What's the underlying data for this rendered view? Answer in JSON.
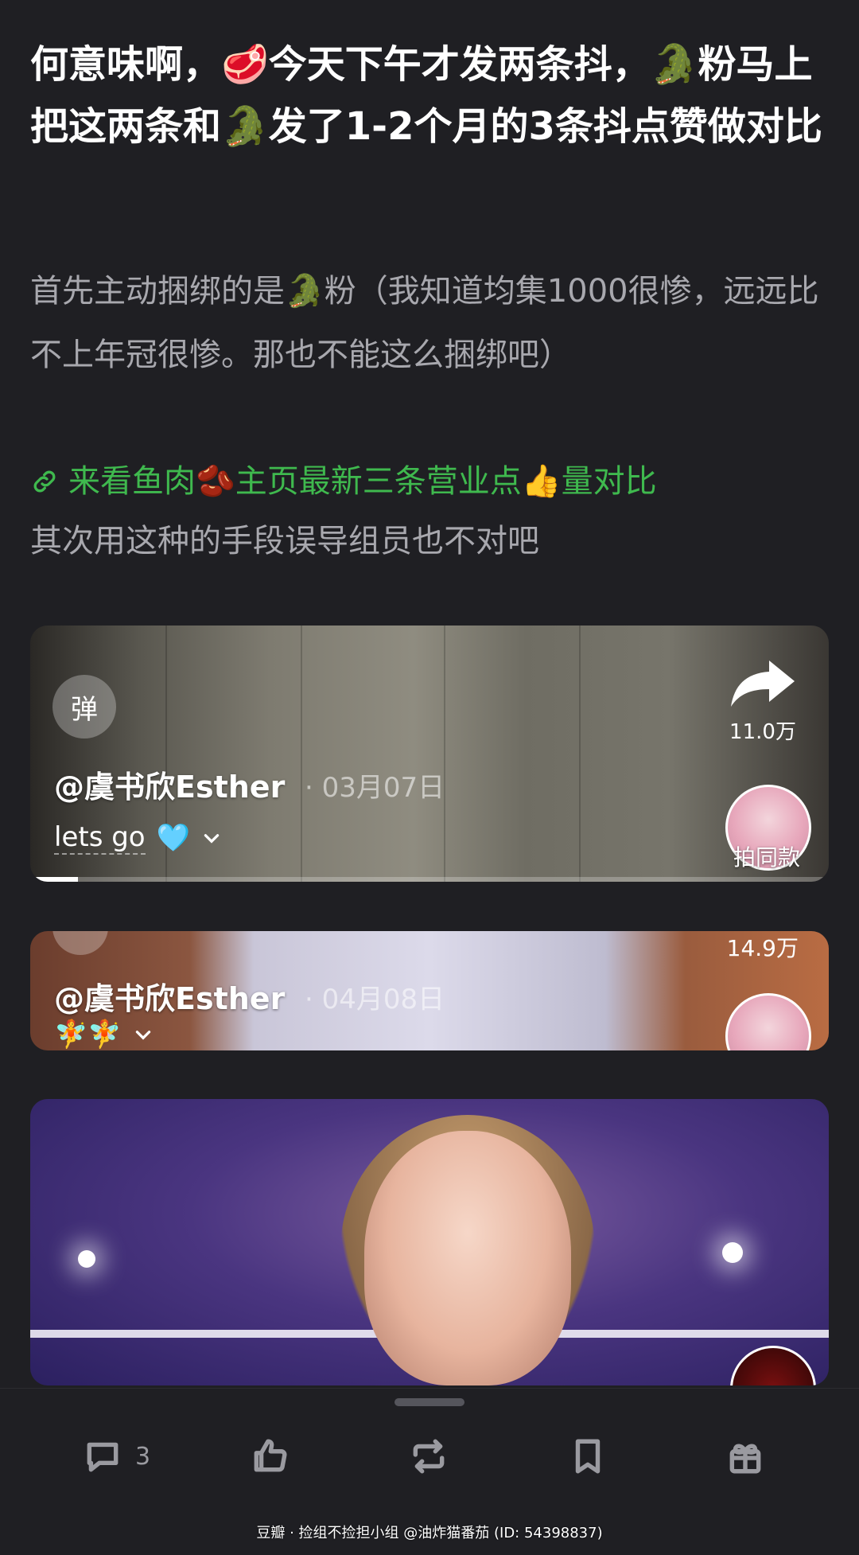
{
  "post": {
    "title": "何意味啊，🥩今天下午才发两条抖，🐊粉马上把这两条和🐊发了1-2个月的3条抖点赞做对比",
    "paragraph1": "首先主动捆绑的是🐊粉（我知道均集1000很惨，远远比不上年冠很惨。那也不能这么捆绑吧）",
    "link_text": "来看鱼肉🫘主页最新三条营业点👍量对比",
    "paragraph2": "其次用这种的手段误导组员也不对吧"
  },
  "videos": [
    {
      "danmu_label": "弹",
      "author": "@虞书欣Esther",
      "date": "· 03月07日",
      "caption": "lets go",
      "caption_emoji": "🩵",
      "share_count": "11.0万",
      "same_style_label": "拍同款",
      "progress": 0.06
    },
    {
      "author": "@虞书欣Esther",
      "date": "· 04月08日",
      "caption_emoji": "🧚🧚",
      "share_count": "14.9万"
    },
    {}
  ],
  "toolbar": {
    "comment_count": "3",
    "icons": [
      "comment-icon",
      "thumbs-up-icon",
      "repost-icon",
      "bookmark-icon",
      "gift-icon"
    ]
  },
  "watermark": "豆瓣 · 捡组不捡担小组 @油炸猫番茄 (ID: 54398837)"
}
